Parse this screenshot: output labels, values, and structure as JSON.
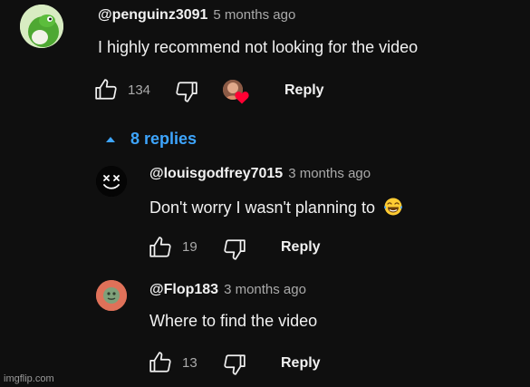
{
  "comment": {
    "author": "@penguinz3091",
    "time": "5 months ago",
    "text": "I highly recommend not looking for the video",
    "likes": "134",
    "reply_label": "Reply",
    "creator_heart": true
  },
  "replies_toggle": {
    "label": "8 replies",
    "icon": "caret-up-icon"
  },
  "replies": [
    {
      "author": "@louisgodfrey7015",
      "time": "3 months ago",
      "text": "Don't worry I wasn't planning to",
      "emoji": "😂",
      "likes": "19",
      "reply_label": "Reply"
    },
    {
      "author": "@Flop183",
      "time": "3 months ago",
      "text": "Where to find the video",
      "likes": "13",
      "reply_label": "Reply"
    }
  ],
  "watermark": "imgflip.com",
  "colors": {
    "background": "#0f0f0f",
    "link": "#3ea6ff",
    "heart": "#ff0033"
  }
}
